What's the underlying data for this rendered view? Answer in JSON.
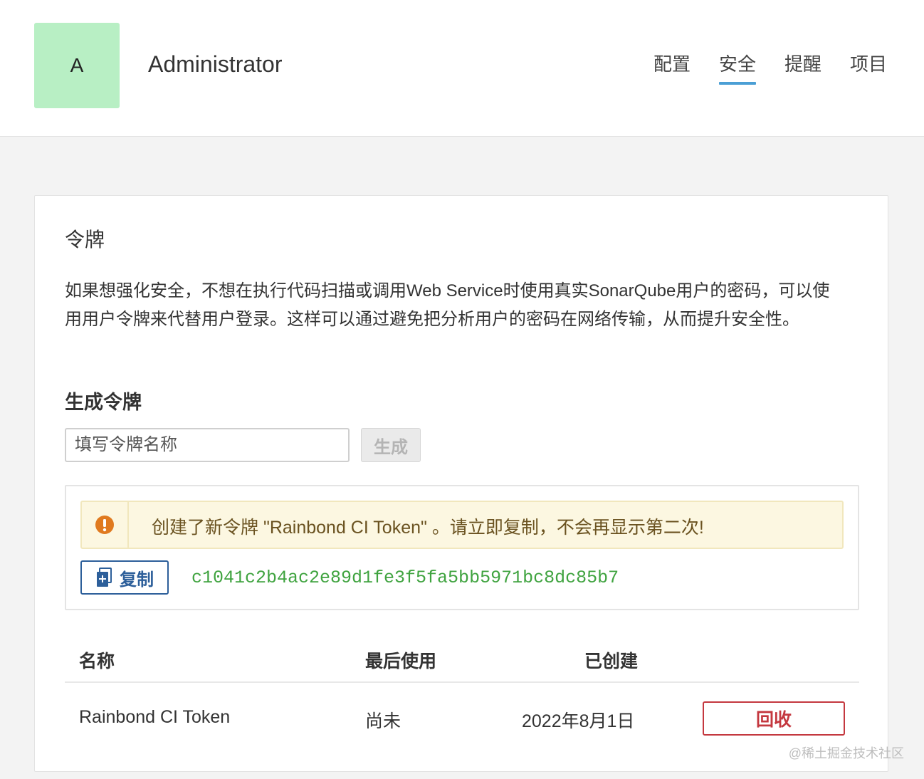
{
  "header": {
    "avatar_letter": "A",
    "username": "Administrator",
    "nav": [
      {
        "label": "配置",
        "active": false
      },
      {
        "label": "安全",
        "active": true
      },
      {
        "label": "提醒",
        "active": false
      },
      {
        "label": "项目",
        "active": false
      }
    ]
  },
  "tokens": {
    "title": "令牌",
    "description": "如果想强化安全，不想在执行代码扫描或调用Web Service时使用真实SonarQube用户的密码，可以使用用户令牌来代替用户登录。这样可以通过避免把分析用户的密码在网络传输，从而提升安全性。",
    "generate_title": "生成令牌",
    "name_placeholder": "填写令牌名称",
    "generate_label": "生成",
    "alert_text": "创建了新令牌 \"Rainbond CI Token\" 。请立即复制，不会再显示第二次!",
    "copy_label": "复制",
    "token_value": "c1041c2b4ac2e89d1fe3f5fa5bb5971bc8dc85b7"
  },
  "table": {
    "headers": {
      "name": "名称",
      "last_used": "最后使用",
      "created": "已创建"
    },
    "rows": [
      {
        "name": "Rainbond CI Token",
        "last_used": "尚未",
        "created": "2022年8月1日",
        "revoke_label": "回收"
      }
    ]
  },
  "watermark": "@稀土掘金技术社区",
  "colors": {
    "accent": "#4b9fd5",
    "success": "#3fa33f",
    "danger": "#c4383f",
    "warning": "#e07a1f"
  }
}
